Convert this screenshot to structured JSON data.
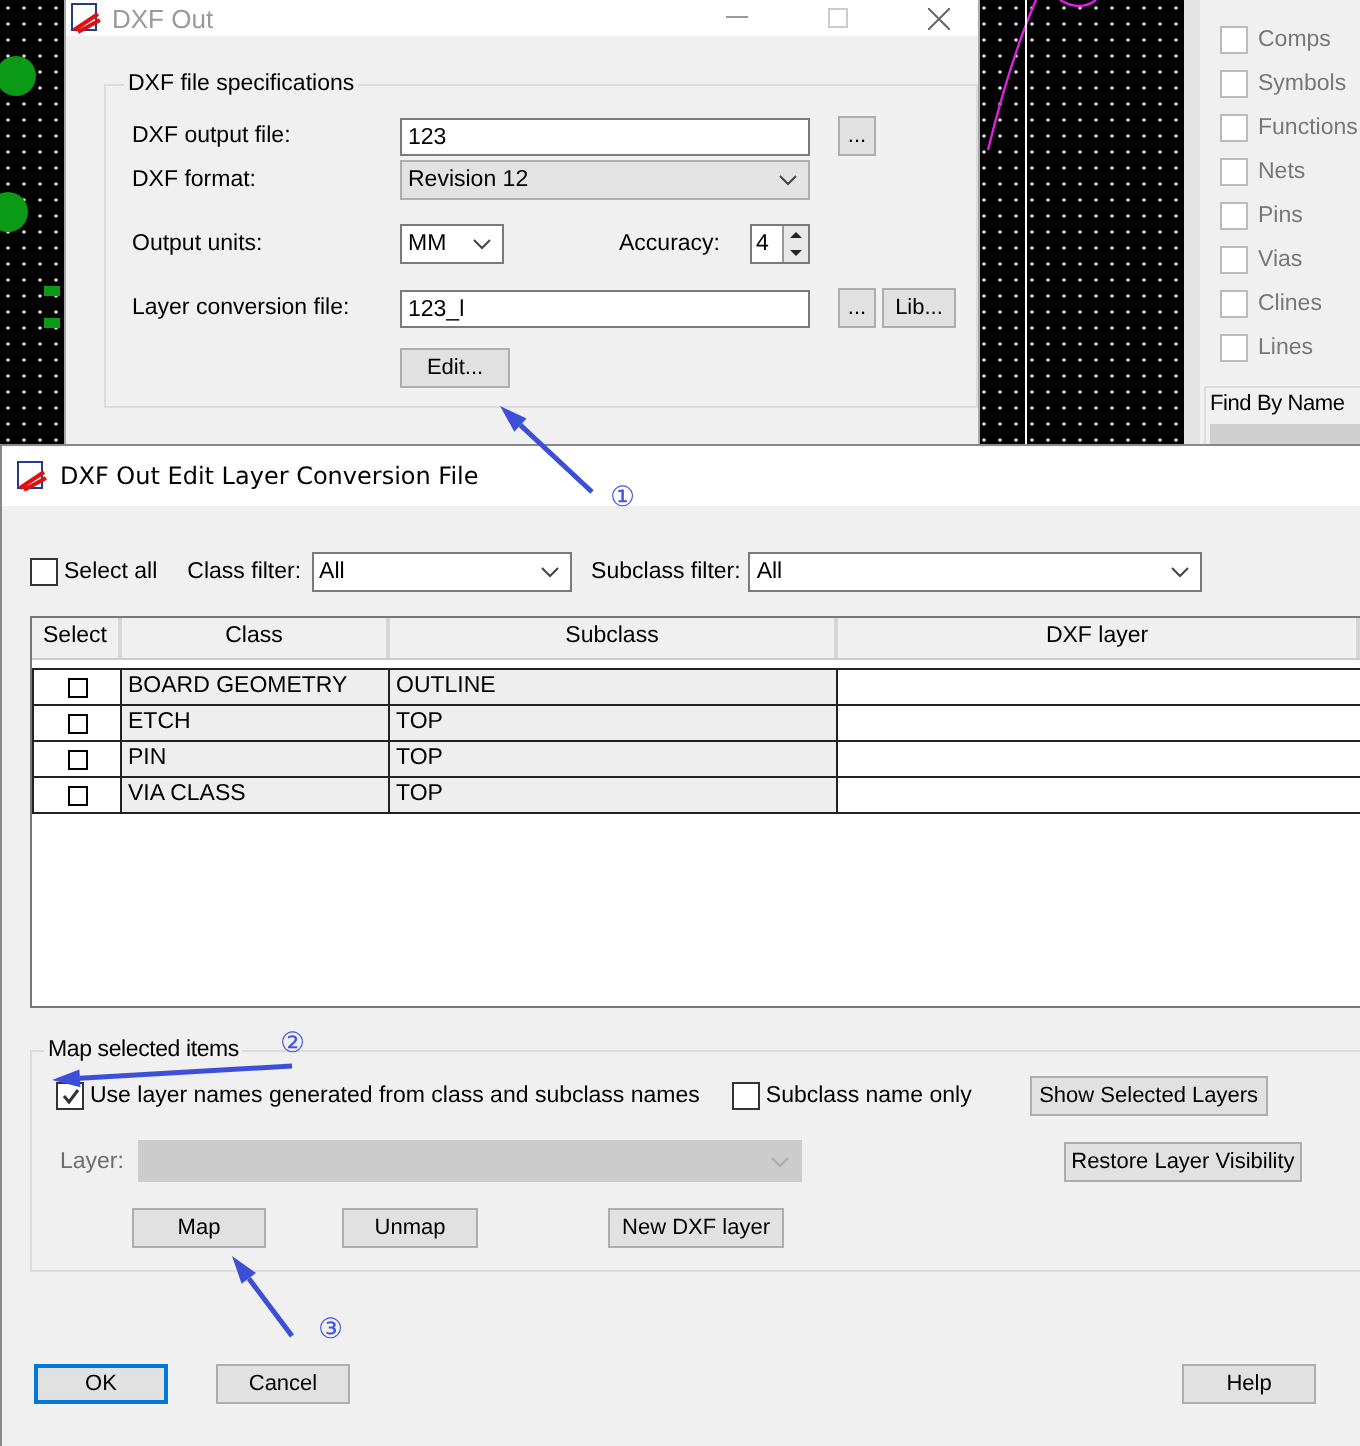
{
  "background": {
    "panel_items": [
      {
        "label": "Comps",
        "checked": false
      },
      {
        "label": "Symbols",
        "checked": false
      },
      {
        "label": "Functions",
        "checked": false
      },
      {
        "label": "Nets",
        "checked": false
      },
      {
        "label": "Pins",
        "checked": false
      },
      {
        "label": "Vias",
        "checked": false
      },
      {
        "label": "Clines",
        "checked": false
      },
      {
        "label": "Lines",
        "checked": false
      }
    ],
    "find_by_name": "Find By Name"
  },
  "dxf_out": {
    "title": "DXF Out",
    "group_title": "DXF file specifications",
    "output_file": {
      "label": "DXF output file:",
      "value": "123",
      "browse": "..."
    },
    "format": {
      "label": "DXF format:",
      "value": "Revision 12"
    },
    "units": {
      "label": "Output units:",
      "value": "MM"
    },
    "accuracy": {
      "label": "Accuracy:",
      "value": "4"
    },
    "layer_file": {
      "label": "Layer conversion file:",
      "value": "123_l",
      "browse": "...",
      "lib": "Lib..."
    },
    "edit_button": "Edit..."
  },
  "edit_dialog": {
    "title": "DXF Out Edit Layer Conversion File",
    "select_all": {
      "label": "Select all",
      "checked": false
    },
    "class_filter": {
      "label": "Class filter:",
      "value": "All"
    },
    "subclass_filter": {
      "label": "Subclass filter:",
      "value": "All"
    },
    "table": {
      "columns": [
        "Select",
        "Class",
        "Subclass",
        "DXF layer"
      ],
      "rows": [
        {
          "checked": false,
          "class": "BOARD GEOMETRY",
          "subclass": "OUTLINE"
        },
        {
          "checked": false,
          "class": "ETCH",
          "subclass": "TOP"
        },
        {
          "checked": false,
          "class": "PIN",
          "subclass": "TOP"
        },
        {
          "checked": false,
          "class": "VIA CLASS",
          "subclass": "TOP"
        }
      ]
    },
    "map_group": {
      "title": "Map selected items",
      "use_generated": {
        "label": "Use layer names generated from class and subclass names",
        "checked": true
      },
      "subclass_only": {
        "label": "Subclass name only",
        "checked": false
      },
      "show_selected": "Show Selected Layers",
      "restore": "Restore Layer Visibility",
      "layer": {
        "label": "Layer:",
        "disabled": true
      },
      "map": "Map",
      "unmap": "Unmap",
      "new_layer": "New DXF layer"
    },
    "buttons": [
      {
        "label": "OK",
        "focused": true
      },
      {
        "label": "Cancel",
        "focused": false
      },
      {
        "label": "Help",
        "focused": false
      }
    ]
  },
  "annotations": [
    {
      "label": "①"
    },
    {
      "label": "②"
    },
    {
      "label": "③"
    }
  ]
}
